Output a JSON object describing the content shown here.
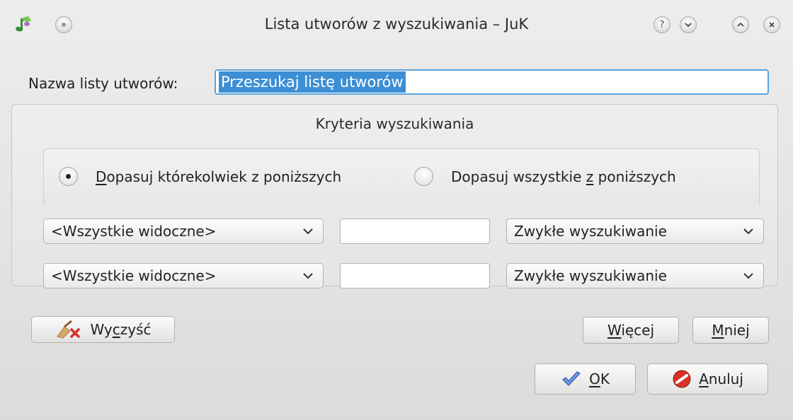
{
  "window": {
    "title": "Lista utworów z wyszukiwania – JuK"
  },
  "form": {
    "name_label": "Nazwa listy utworów:",
    "name_value": "Przeszukaj listę utworów"
  },
  "criteria": {
    "group_title": "Kryteria wyszukiwania",
    "match_any_pre": "",
    "match_any_mnemonic": "D",
    "match_any_post": "opasuj którekolwiek z poniższych",
    "match_all_pre": "Dopasuj wszystkie ",
    "match_all_mnemonic": "z",
    "match_all_post": " poniższych",
    "selected": "any",
    "rows": [
      {
        "column": "<Wszystkie widoczne>",
        "text": "",
        "mode": "Zwykłe wyszukiwanie"
      },
      {
        "column": "<Wszystkie widoczne>",
        "text": "",
        "mode": "Zwykłe wyszukiwanie"
      }
    ]
  },
  "buttons": {
    "clear_pre": "Wy",
    "clear_mnemonic": "c",
    "clear_post": "zyść",
    "more_pre": "",
    "more_mnemonic": "W",
    "more_post": "ięcej",
    "less_pre": "",
    "less_mnemonic": "M",
    "less_post": "niej",
    "ok_pre": "",
    "ok_mnemonic": "O",
    "ok_post": "K",
    "cancel_pre": "",
    "cancel_mnemonic": "A",
    "cancel_post": "nuluj"
  },
  "icons": {
    "app": "juk-note-icon",
    "clear": "broom-clear-icon",
    "ok": "checkmark-icon",
    "cancel": "cancel-icon"
  },
  "colors": {
    "selection": "#3c8fd4",
    "focus_border": "#5ba4d9",
    "cancel_red": "#d9302a",
    "ok_blue": "#4b79c2"
  }
}
